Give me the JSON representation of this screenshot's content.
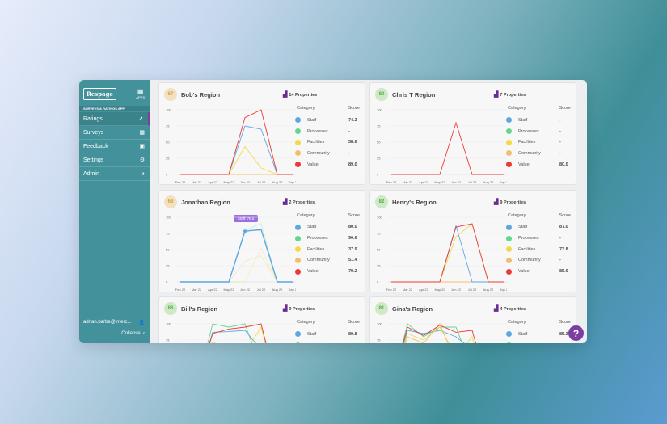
{
  "sidebar": {
    "logo": "Respage",
    "apps_label": "APPS",
    "section": "SURVEYS & RATINGS APP",
    "items": [
      {
        "label": "Ratings",
        "icon": "trending-up-icon",
        "glyph": "↗",
        "active": true
      },
      {
        "label": "Surveys",
        "icon": "table-icon",
        "glyph": "▦"
      },
      {
        "label": "Feedback",
        "icon": "feedback-icon",
        "glyph": "▣"
      },
      {
        "label": "Settings",
        "icon": "gear-icon",
        "glyph": "⚙"
      },
      {
        "label": "Admin",
        "icon": "admin-icon",
        "glyph": "◕"
      }
    ],
    "user": "adrian.barbe@interc...",
    "collapse": "Collapse"
  },
  "colors": {
    "Staff": "#5aa8e4",
    "Processes": "#62d68d",
    "Facilities": "#f1da47",
    "Community": "#f0bf6e",
    "Value": "#ec3a36"
  },
  "months": [
    "Feb 22",
    "Mar 22",
    "Apr 22",
    "May 22",
    "Jun 22",
    "Jul 22",
    "Aug 22",
    "Sep 22"
  ],
  "yticks": [
    0,
    25,
    50,
    75,
    100
  ],
  "legend_header": {
    "category": "Category",
    "score": "Score"
  },
  "categories": [
    "Staff",
    "Processes",
    "Facilities",
    "Community",
    "Value"
  ],
  "cards": [
    {
      "score": "67",
      "name": "Bob's Region",
      "properties": "14 Properties",
      "tone": "orange",
      "scores": [
        "74.3",
        "-",
        "38.6",
        "-",
        "89.0"
      ],
      "series": {
        "Community": [
          0,
          0,
          0,
          0,
          0,
          0,
          0,
          0
        ],
        "Staff": [
          0,
          0,
          0,
          0,
          75,
          70,
          0,
          0
        ],
        "Facilities": [
          0,
          0,
          0,
          0,
          43,
          10,
          0,
          0
        ],
        "Value": [
          0,
          0,
          0,
          0,
          88,
          100,
          0,
          0
        ]
      }
    },
    {
      "score": "80",
      "name": "Chris T Region",
      "properties": "7 Properties",
      "tone": "green",
      "scores": [
        "-",
        "-",
        "-",
        "-",
        "80.0"
      ],
      "series": {
        "Value": [
          0,
          0,
          0,
          0,
          80,
          0,
          0,
          0
        ]
      }
    },
    {
      "score": "68",
      "name": "Jonathan Region",
      "properties": "2 Properties",
      "tone": "orange",
      "scores": [
        "80.0",
        "90.6",
        "37.9",
        "51.4",
        "79.2"
      ],
      "tooltip": "Staff: 78.5",
      "highlight": "Staff",
      "series": {
        "Processes": [
          0,
          0,
          0,
          0,
          80,
          90,
          0,
          0
        ],
        "Facilities": [
          0,
          0,
          0,
          0,
          0,
          52,
          0,
          0
        ],
        "Community": [
          0,
          0,
          0,
          0,
          32,
          40,
          0,
          0
        ],
        "Value": [
          0,
          0,
          0,
          0,
          79,
          80,
          0,
          0
        ],
        "Staff": [
          0,
          0,
          0,
          0,
          78.5,
          81,
          0,
          0
        ]
      }
    },
    {
      "score": "82",
      "name": "Henry's Region",
      "properties": "9 Properties",
      "tone": "green",
      "scores": [
        "87.0",
        "-",
        "73.8",
        "-",
        "85.0"
      ],
      "series": {
        "Community": [
          0,
          0,
          0,
          0,
          0,
          0,
          0,
          0
        ],
        "Staff": [
          0,
          0,
          0,
          0,
          87,
          0,
          0,
          0
        ],
        "Facilities": [
          0,
          0,
          0,
          0,
          70,
          90,
          0,
          0
        ],
        "Value": [
          0,
          0,
          0,
          0,
          85,
          90,
          0,
          0
        ]
      }
    },
    {
      "score": "86",
      "name": "Bill's Region",
      "properties": "9 Properties",
      "tone": "green",
      "scores": [
        "89.8",
        "",
        "",
        "",
        ""
      ],
      "series": {
        "Processes": [
          0,
          0,
          100,
          95,
          100,
          30,
          0,
          0
        ],
        "Staff": [
          0,
          0,
          87,
          88,
          90,
          60,
          0,
          0
        ],
        "Facilities": [
          0,
          0,
          72,
          60,
          55,
          95,
          0,
          0
        ],
        "Value": [
          0,
          0,
          85,
          92,
          95,
          100,
          0,
          0
        ]
      }
    },
    {
      "score": "81",
      "name": "Gina's Region",
      "properties": "4 Properties",
      "tone": "green",
      "scores": [
        "85.3",
        "",
        "",
        "",
        ""
      ],
      "series": {
        "Processes": [
          0,
          100,
          80,
          95,
          95,
          30,
          0,
          0
        ],
        "Staff": [
          0,
          90,
          85,
          90,
          80,
          60,
          0,
          0
        ],
        "Facilities": [
          0,
          85,
          75,
          95,
          50,
          80,
          0,
          0
        ],
        "Community": [
          0,
          80,
          70,
          100,
          40,
          60,
          0,
          0
        ],
        "Value": [
          0,
          95,
          82,
          98,
          87,
          90,
          0,
          0
        ]
      }
    }
  ],
  "help": "?"
}
